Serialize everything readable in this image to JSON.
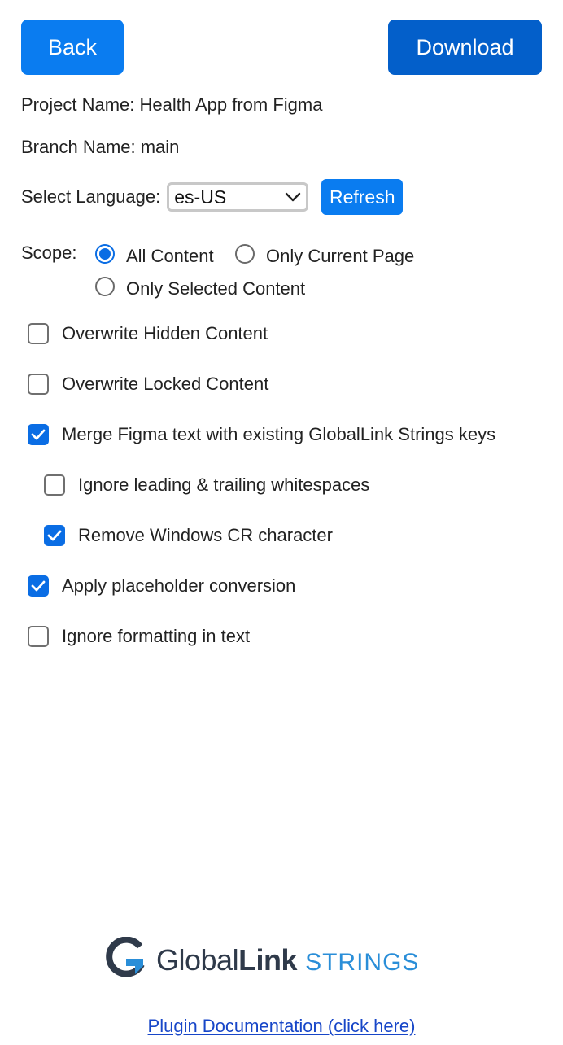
{
  "header": {
    "back_label": "Back",
    "download_label": "Download"
  },
  "project": {
    "name_text": "Project Name: Health App from Figma",
    "branch_text": "Branch Name: main"
  },
  "language": {
    "label": "Select Language:",
    "selected": "es-US",
    "refresh_label": "Refresh"
  },
  "scope": {
    "label": "Scope:",
    "options": [
      {
        "label": "All Content",
        "checked": true
      },
      {
        "label": "Only Current Page",
        "checked": false
      },
      {
        "label": "Only Selected Content",
        "checked": false
      }
    ]
  },
  "options": [
    {
      "label": "Overwrite Hidden Content",
      "checked": false
    },
    {
      "label": "Overwrite Locked Content",
      "checked": false
    },
    {
      "label": "Merge Figma text with existing GlobalLink Strings keys",
      "checked": true
    },
    {
      "label": "Ignore leading & trailing whitespaces",
      "checked": false
    },
    {
      "label": "Remove Windows CR character",
      "checked": true
    },
    {
      "label": "Apply placeholder conversion",
      "checked": true
    },
    {
      "label": "Ignore formatting in text",
      "checked": false
    }
  ],
  "footer": {
    "logo": {
      "word1": "Global",
      "word2": "Link",
      "word3": "STRINGS"
    },
    "doc_link": "Plugin Documentation (click here)"
  },
  "colors": {
    "primary": "#0a7cf0",
    "primary_dark": "#035fca",
    "checked": "#0a6de4",
    "link": "#1746c8"
  }
}
